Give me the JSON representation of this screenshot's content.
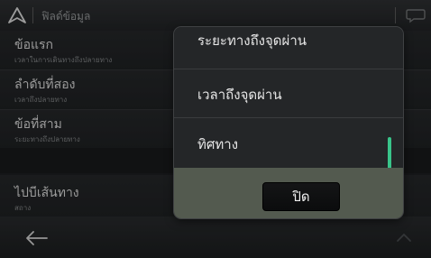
{
  "topbar": {
    "title": "ฟิลด์ข้อมูล",
    "nav_icon": "navigation-arrow-icon",
    "chat_icon": "chat-bubble-icon"
  },
  "background_list": [
    {
      "title": "ข้อแรก",
      "subtitle": "เวลาในการเดินทางถึงปลายทาง"
    },
    {
      "title": "ลำดับที่สอง",
      "subtitle": "เวลาถึงปลายทาง"
    },
    {
      "title": "ข้อที่สาม",
      "subtitle": "ระยะทางถึงปลายทาง"
    },
    {
      "title": "ไปบีเส้นทาง",
      "subtitle": "สถาง"
    }
  ],
  "popup": {
    "options": [
      "ระยะทางถึงจุดผ่าน",
      "เวลาถึงจุดผ่าน",
      "ทิศทาง"
    ],
    "close_label": "ปิด",
    "accent_color": "#39c48a"
  },
  "bottombar": {
    "back_icon": "back-arrow-icon",
    "up_icon": "chevron-up-icon"
  }
}
